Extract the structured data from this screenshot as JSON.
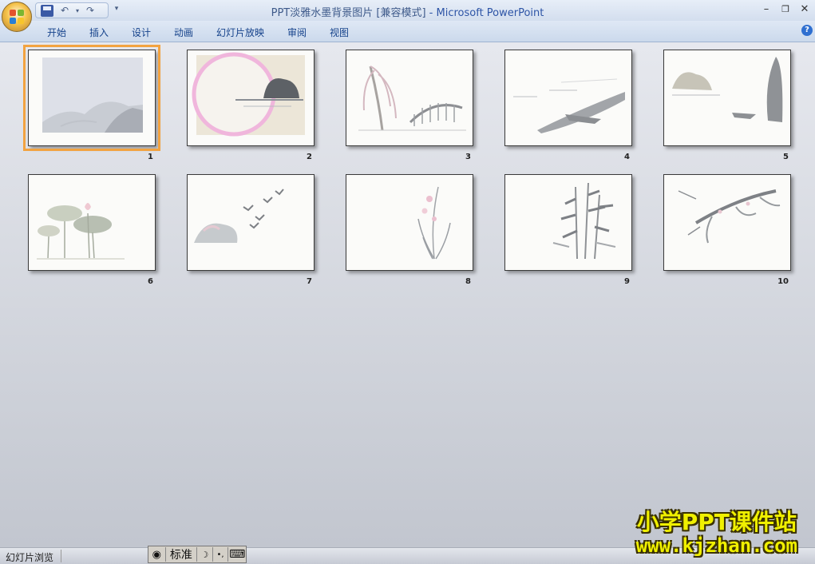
{
  "window": {
    "title_doc": "PPT淡雅水墨背景图片 [兼容模式]",
    "title_sep": " - ",
    "title_app": "Microsoft PowerPoint",
    "minimize": "–",
    "restore": "❐",
    "close": "✕"
  },
  "quick_access": {
    "undo": "↶",
    "redo": "↷",
    "customize": "▾"
  },
  "tabs": [
    "开始",
    "插入",
    "设计",
    "动画",
    "幻灯片放映",
    "审阅",
    "视图"
  ],
  "help": "?",
  "slides": [
    {
      "number": "1",
      "scene": "misty-mountains",
      "selected": true
    },
    {
      "number": "2",
      "scene": "moon-island"
    },
    {
      "number": "3",
      "scene": "willow-bridge"
    },
    {
      "number": "4",
      "scene": "boat-shore"
    },
    {
      "number": "5",
      "scene": "cliff-boat"
    },
    {
      "number": "6",
      "scene": "lotus"
    },
    {
      "number": "7",
      "scene": "birds"
    },
    {
      "number": "8",
      "scene": "orchid"
    },
    {
      "number": "9",
      "scene": "bamboo"
    },
    {
      "number": "10",
      "scene": "plum-branch"
    }
  ],
  "status": {
    "view_label": "幻灯片浏览"
  },
  "ime": {
    "mode_label": "标准",
    "moon": "☽",
    "dots": "•,",
    "keyboard": "⌨"
  },
  "watermark": {
    "line1": "小学PPT课件站",
    "line2": "www.kjzhan.com"
  },
  "colors": {
    "selection": "#f2a341",
    "accent": "#2d54a6"
  }
}
